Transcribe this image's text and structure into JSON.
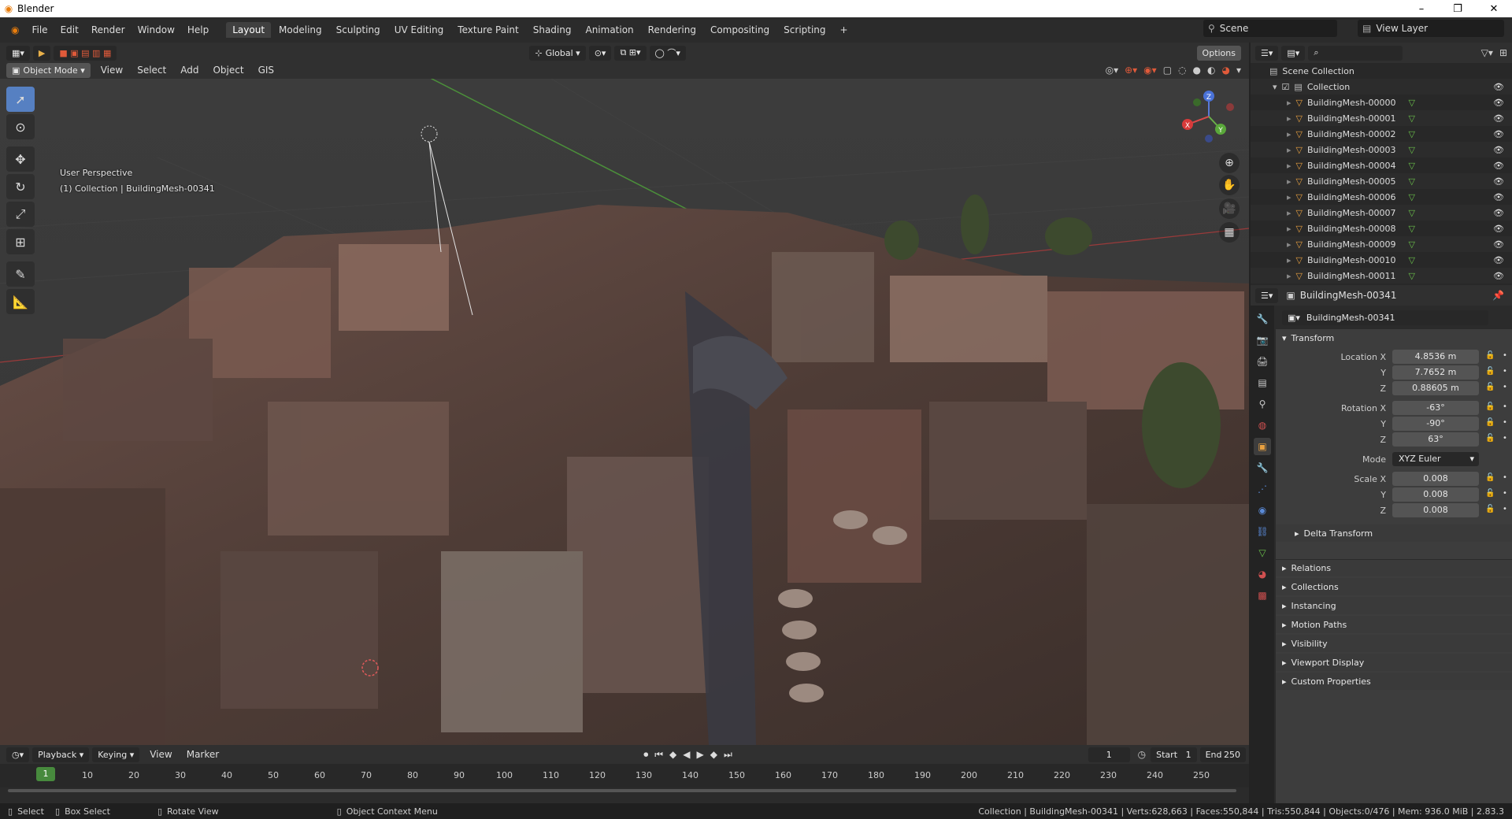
{
  "window": {
    "title": "Blender",
    "controls": [
      "–",
      "❐",
      "✕"
    ]
  },
  "menu": [
    "File",
    "Edit",
    "Render",
    "Window",
    "Help"
  ],
  "workspaces": [
    "Layout",
    "Modeling",
    "Sculpting",
    "UV Editing",
    "Texture Paint",
    "Shading",
    "Animation",
    "Rendering",
    "Compositing",
    "Scripting"
  ],
  "active_workspace": "Layout",
  "scene": {
    "name": "Scene",
    "view_layer": "View Layer"
  },
  "viewport_header": {
    "transform_orientation": "Global",
    "options": "Options"
  },
  "viewport_menu": {
    "mode": "Object Mode",
    "items": [
      "View",
      "Select",
      "Add",
      "Object",
      "GIS"
    ]
  },
  "viewport_info": {
    "line1": "User Perspective",
    "line2": "(1) Collection | BuildingMesh-00341"
  },
  "gizmo": {
    "x": "X",
    "y": "Y",
    "z": "Z"
  },
  "outliner": {
    "root": "Scene Collection",
    "collection": "Collection",
    "items": [
      "BuildingMesh-00000",
      "BuildingMesh-00001",
      "BuildingMesh-00002",
      "BuildingMesh-00003",
      "BuildingMesh-00004",
      "BuildingMesh-00005",
      "BuildingMesh-00006",
      "BuildingMesh-00007",
      "BuildingMesh-00008",
      "BuildingMesh-00009",
      "BuildingMesh-00010",
      "BuildingMesh-00011"
    ]
  },
  "properties": {
    "object_name": "BuildingMesh-00341",
    "data_name": "BuildingMesh-00341",
    "transform_label": "Transform",
    "location_label": "Location X",
    "rotation_label": "Rotation X",
    "scale_label": "Scale X",
    "y_label": "Y",
    "z_label": "Z",
    "mode_label": "Mode",
    "location": {
      "x": "4.8536 m",
      "y": "7.7652 m",
      "z": "0.88605 m"
    },
    "rotation": {
      "x": "-63°",
      "y": "-90°",
      "z": "63°"
    },
    "mode": "XYZ Euler",
    "scale": {
      "x": "0.008",
      "y": "0.008",
      "z": "0.008"
    },
    "delta": "Delta Transform",
    "sections": [
      "Relations",
      "Collections",
      "Instancing",
      "Motion Paths",
      "Visibility",
      "Viewport Display",
      "Custom Properties"
    ]
  },
  "timeline": {
    "menus": [
      "Playback",
      "Keying",
      "View",
      "Marker"
    ],
    "current_frame": "1",
    "start_label": "Start",
    "start": "1",
    "end_label": "End",
    "end": "250",
    "ruler": [
      "1",
      "10",
      "20",
      "30",
      "40",
      "50",
      "60",
      "70",
      "80",
      "90",
      "100",
      "110",
      "120",
      "130",
      "140",
      "150",
      "160",
      "170",
      "180",
      "190",
      "200",
      "210",
      "220",
      "230",
      "240",
      "250"
    ]
  },
  "status": {
    "select": "Select",
    "box_select": "Box Select",
    "rotate_view": "Rotate View",
    "context_menu": "Object Context Menu",
    "stats": "Collection | BuildingMesh-00341 | Verts:628,663 | Faces:550,844 | Tris:550,844 | Objects:0/476 | Mem: 936.0 MiB | 2.83.3"
  }
}
